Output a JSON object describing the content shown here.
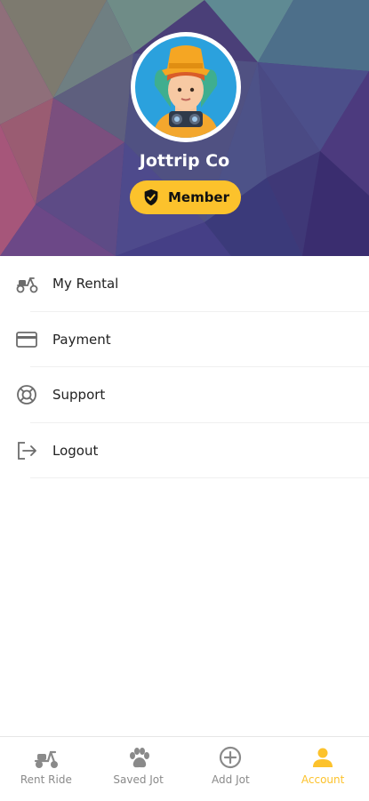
{
  "profile": {
    "name": "Jottrip Co",
    "badge": "Member"
  },
  "menu": [
    {
      "icon": "scooter-icon",
      "label": "My Rental"
    },
    {
      "icon": "credit-card-icon",
      "label": "Payment"
    },
    {
      "icon": "lifebuoy-icon",
      "label": "Support"
    },
    {
      "icon": "logout-icon",
      "label": "Logout"
    }
  ],
  "nav": [
    {
      "icon": "scooter-icon",
      "label": "Rent Ride",
      "active": false
    },
    {
      "icon": "paw-icon",
      "label": "Saved Jot",
      "active": false
    },
    {
      "icon": "add-circle-icon",
      "label": "Add Jot",
      "active": false
    },
    {
      "icon": "person-icon",
      "label": "Account",
      "active": true
    }
  ],
  "colors": {
    "accent": "#fcc22c",
    "inactive": "#8a8a8a"
  }
}
